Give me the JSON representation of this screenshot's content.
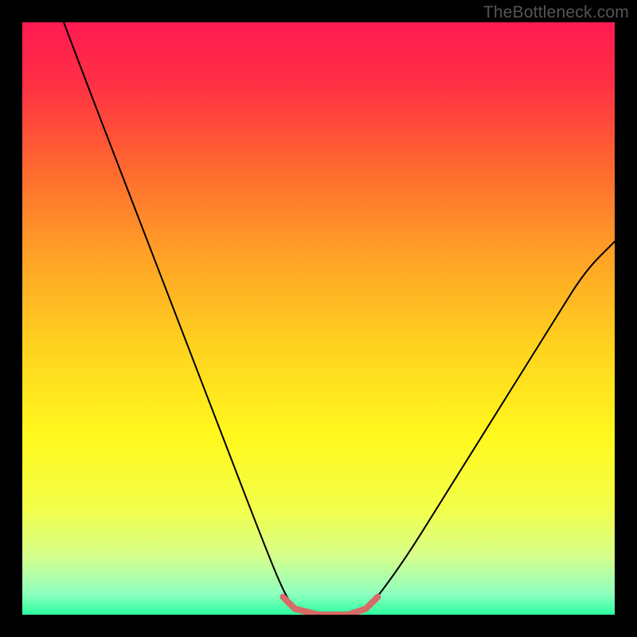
{
  "watermark": "TheBottleneck.com",
  "chart_data": {
    "type": "line",
    "title": "",
    "xlabel": "",
    "ylabel": "",
    "xlim": [
      0,
      100
    ],
    "ylim": [
      0,
      100
    ],
    "background": {
      "kind": "vertical-gradient",
      "stops": [
        {
          "pos": 0.0,
          "color": "#ff1a52"
        },
        {
          "pos": 0.1,
          "color": "#ff2f45"
        },
        {
          "pos": 0.25,
          "color": "#ff6a2f"
        },
        {
          "pos": 0.4,
          "color": "#ffa426"
        },
        {
          "pos": 0.55,
          "color": "#ffd31f"
        },
        {
          "pos": 0.7,
          "color": "#fff81e"
        },
        {
          "pos": 0.82,
          "color": "#f3ff4a"
        },
        {
          "pos": 0.9,
          "color": "#d6ff8a"
        },
        {
          "pos": 0.965,
          "color": "#8effc0"
        },
        {
          "pos": 1.0,
          "color": "#2bff9e"
        }
      ]
    },
    "series": [
      {
        "name": "bottleneck-curve",
        "stroke": "#000000",
        "stroke_width": 2,
        "points": [
          {
            "x": 7,
            "y": 100
          },
          {
            "x": 10,
            "y": 92
          },
          {
            "x": 15,
            "y": 79
          },
          {
            "x": 20,
            "y": 66
          },
          {
            "x": 25,
            "y": 53
          },
          {
            "x": 30,
            "y": 40
          },
          {
            "x": 35,
            "y": 27
          },
          {
            "x": 40,
            "y": 14
          },
          {
            "x": 44,
            "y": 4
          },
          {
            "x": 46,
            "y": 1
          },
          {
            "x": 50,
            "y": 0
          },
          {
            "x": 55,
            "y": 0
          },
          {
            "x": 58,
            "y": 1
          },
          {
            "x": 60,
            "y": 3
          },
          {
            "x": 65,
            "y": 10
          },
          {
            "x": 70,
            "y": 18
          },
          {
            "x": 75,
            "y": 26
          },
          {
            "x": 80,
            "y": 34
          },
          {
            "x": 85,
            "y": 42
          },
          {
            "x": 90,
            "y": 50
          },
          {
            "x": 95,
            "y": 58
          },
          {
            "x": 100,
            "y": 63
          }
        ]
      },
      {
        "name": "optimal-range-marker",
        "stroke": "#d66b67",
        "stroke_width": 8,
        "points": [
          {
            "x": 44,
            "y": 3
          },
          {
            "x": 46,
            "y": 1
          },
          {
            "x": 50,
            "y": 0
          },
          {
            "x": 55,
            "y": 0
          },
          {
            "x": 58,
            "y": 1
          },
          {
            "x": 60,
            "y": 3
          }
        ]
      }
    ]
  }
}
